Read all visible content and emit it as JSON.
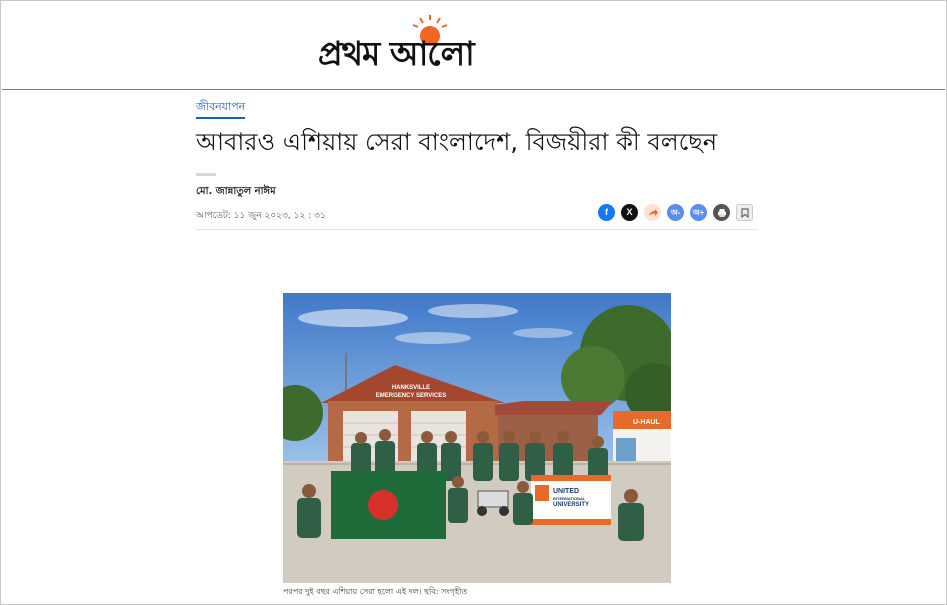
{
  "site": {
    "logo_text": "প্রথম আলো",
    "logo_accent": "#f26522"
  },
  "article": {
    "category": "জীবনযাপন",
    "headline": "আবারও এশিয়ায় সেরা বাংলাদেশ, বিজয়ীরা কী বলছেন",
    "author": "মো. জান্নাতুল নাঈম",
    "published": "আপডেট: ১১ জুন ২০২৩, ১২ : ৩১",
    "share_buttons": [
      {
        "icon": "facebook-icon",
        "color": "#1877f2"
      },
      {
        "icon": "x-icon",
        "color": "#111111"
      },
      {
        "icon": "share-icon",
        "color": "#f26522"
      },
      {
        "icon": "font-decrease-icon",
        "color": "#5b8def"
      },
      {
        "icon": "font-increase-icon",
        "color": "#5b8def"
      },
      {
        "icon": "print-icon",
        "color": "#555555"
      },
      {
        "icon": "bookmark-icon",
        "color": "#777777"
      }
    ],
    "photo": {
      "building_sign": [
        "HANKSVILLE",
        "EMERGENCY SERVICES"
      ],
      "banner_text": [
        "UNITED",
        "INTERNATIONAL",
        "UNIVERSITY"
      ],
      "truck_text": "U-HAUL"
    },
    "caption": "পরপর দুই বছর এশিয়ায় সেরা হলো এই দল। ছবি: সংগৃহীত"
  }
}
